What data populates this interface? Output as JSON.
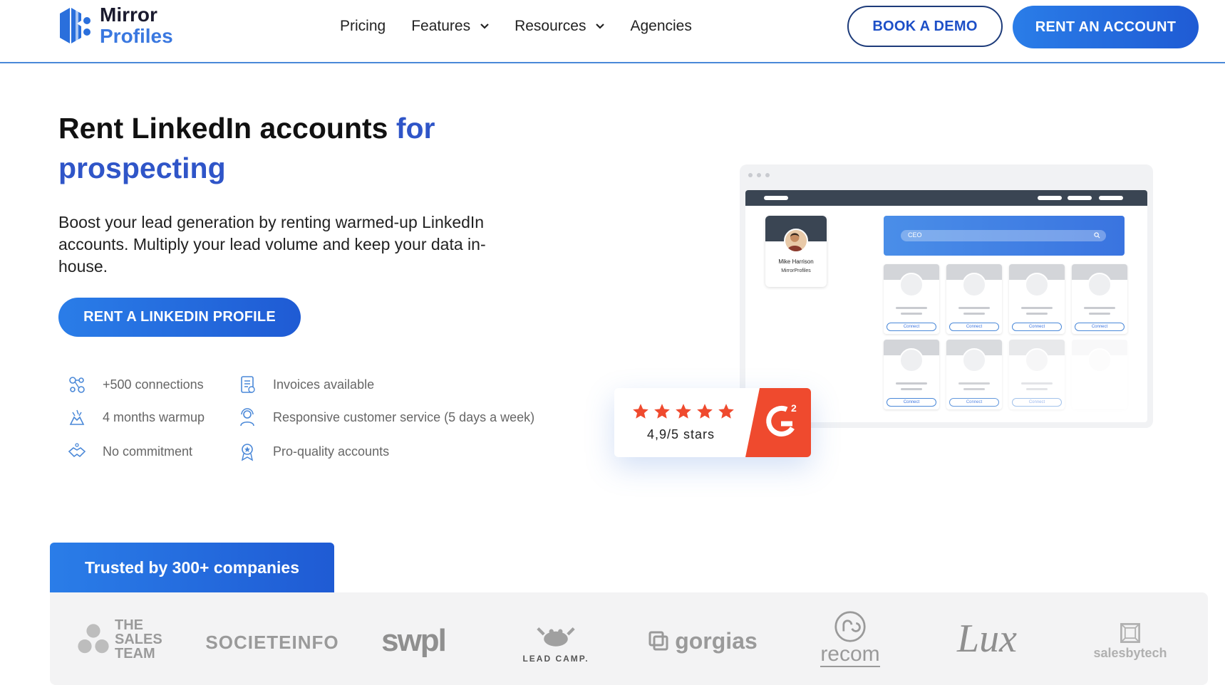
{
  "brand": {
    "name_line1": "Mirror",
    "name_line2": "Profiles"
  },
  "nav": {
    "items": [
      {
        "label": "Pricing",
        "dropdown": false
      },
      {
        "label": "Features",
        "dropdown": true
      },
      {
        "label": "Resources",
        "dropdown": true
      },
      {
        "label": "Agencies",
        "dropdown": false
      }
    ],
    "book_demo": "BOOK A DEMO",
    "rent_account": "RENT AN ACCOUNT"
  },
  "hero": {
    "title_main": "Rent LinkedIn accounts ",
    "title_accent": "for prospecting",
    "description": "Boost your lead generation by renting warmed-up LinkedIn accounts. Multiply your lead volume and keep your data in-house.",
    "cta": "RENT A LINKEDIN PROFILE"
  },
  "features": [
    {
      "label": "+500 connections",
      "icon": "network-icon"
    },
    {
      "label": "Invoices available",
      "icon": "invoice-icon"
    },
    {
      "label": "4 months warmup",
      "icon": "warmup-icon"
    },
    {
      "label": "Responsive customer service (5 days a week)",
      "icon": "support-agent-icon"
    },
    {
      "label": "No commitment",
      "icon": "handshake-icon"
    },
    {
      "label": "Pro-quality accounts",
      "icon": "quality-badge-icon"
    }
  ],
  "mockup": {
    "profile_name": "Mike Harrison",
    "profile_company": "MirrorProfiles",
    "search_value": "CEO",
    "connect_label": "Connect"
  },
  "rating": {
    "stars": 5,
    "text": "4,9/5 stars",
    "badge": "G2"
  },
  "trusted": {
    "heading": "Trusted by 300+ companies",
    "logos": [
      "THE SALES TEAM",
      "SOCIETEINFO",
      "swpl",
      "LEAD CAMP.",
      "gorgias",
      "recom",
      "Lux",
      "salesbytech"
    ]
  },
  "colors": {
    "accent": "#2f55c8",
    "primary_button": "#2a7de8",
    "g2_red": "#ef4a2e"
  }
}
